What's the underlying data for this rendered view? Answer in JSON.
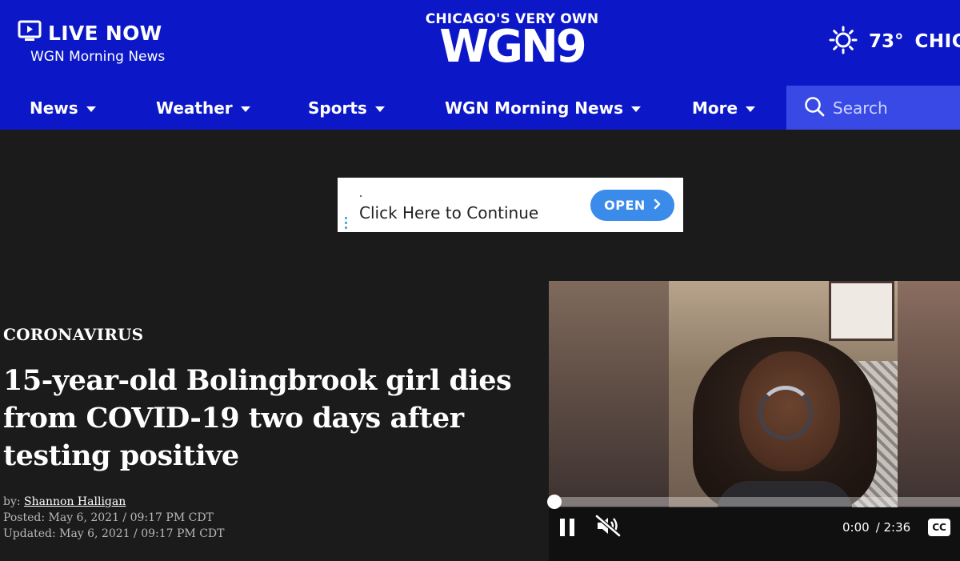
{
  "header": {
    "live_label": "LIVE NOW",
    "live_show": "WGN Morning News",
    "logo_top": "CHICAGO'S VERY OWN",
    "logo_main": "WGN9",
    "weather_temp": "73°",
    "weather_city": "CHIC"
  },
  "nav": {
    "items": [
      {
        "label": "News"
      },
      {
        "label": "Weather"
      },
      {
        "label": "Sports"
      },
      {
        "label": "WGN Morning News"
      },
      {
        "label": "More"
      }
    ],
    "search_placeholder": "Search"
  },
  "ad": {
    "text": "Click Here to Continue",
    "button_label": "OPEN"
  },
  "article": {
    "category": "CORONAVIRUS",
    "headline": "15-year-old Bolingbrook girl dies from COVID-19 two days after testing positive",
    "byline_prefix": "by:",
    "author": "Shannon Halligan",
    "posted": "Posted: May 6, 2021 / 09:17 PM CDT",
    "updated": "Updated: May 6, 2021 / 09:17 PM CDT"
  },
  "video": {
    "current_time": "0:00",
    "duration": "/ 2:36",
    "progress_fraction": 0.0,
    "cc_label": "CC"
  },
  "colors": {
    "brand_blue": "#0c18c7",
    "search_bg": "#3849e6",
    "page_bg": "#1b1b1b",
    "ad_button": "#3b8beb"
  }
}
